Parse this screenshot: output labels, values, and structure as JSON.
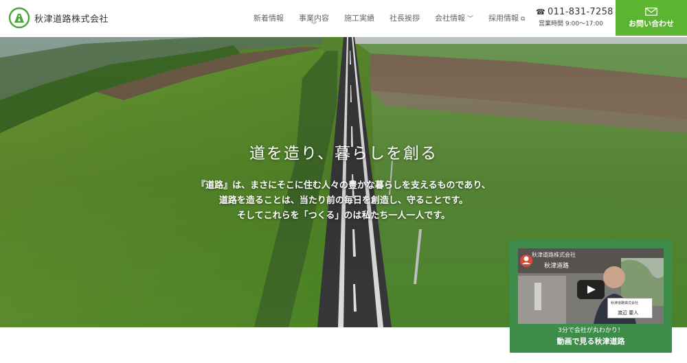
{
  "header": {
    "company_name": "秋津道路株式会社",
    "nav": [
      {
        "label": "新着情報"
      },
      {
        "label": "事業内容",
        "under": "︾"
      },
      {
        "label": "施工実績"
      },
      {
        "label": "社長挨拶"
      },
      {
        "label": "会社情報",
        "chevron": "﹀"
      },
      {
        "label": "採用情報",
        "external": "⧉"
      }
    ],
    "phone": "011-831-7258",
    "phone_icon": "☎",
    "hours": "営業時間 9:00〜17:00",
    "contact_button": "お問い合わせ",
    "accent_color": "#5cb530"
  },
  "hero": {
    "title": "道を造り、暮らしを創る",
    "lines": [
      "『道路』は、まさにそこに住む人々の豊かな暮らしを支えるものであり、",
      "道路を造ることは、当たり前の毎日を創造し、守ることです。",
      "そしてこれらを「つくる」のは私たち一人一人です。"
    ]
  },
  "video": {
    "thumb_header": "秋津道路株式会社",
    "thumb_channel": "秋津道路",
    "name_card_company": "秋津道路株式会社",
    "name_card_name": "渡辺 要人",
    "caption_sub": "3分で会社が丸わかり！",
    "caption_main": "動画で見る秋津道路",
    "card_color": "#3d8c4a"
  }
}
